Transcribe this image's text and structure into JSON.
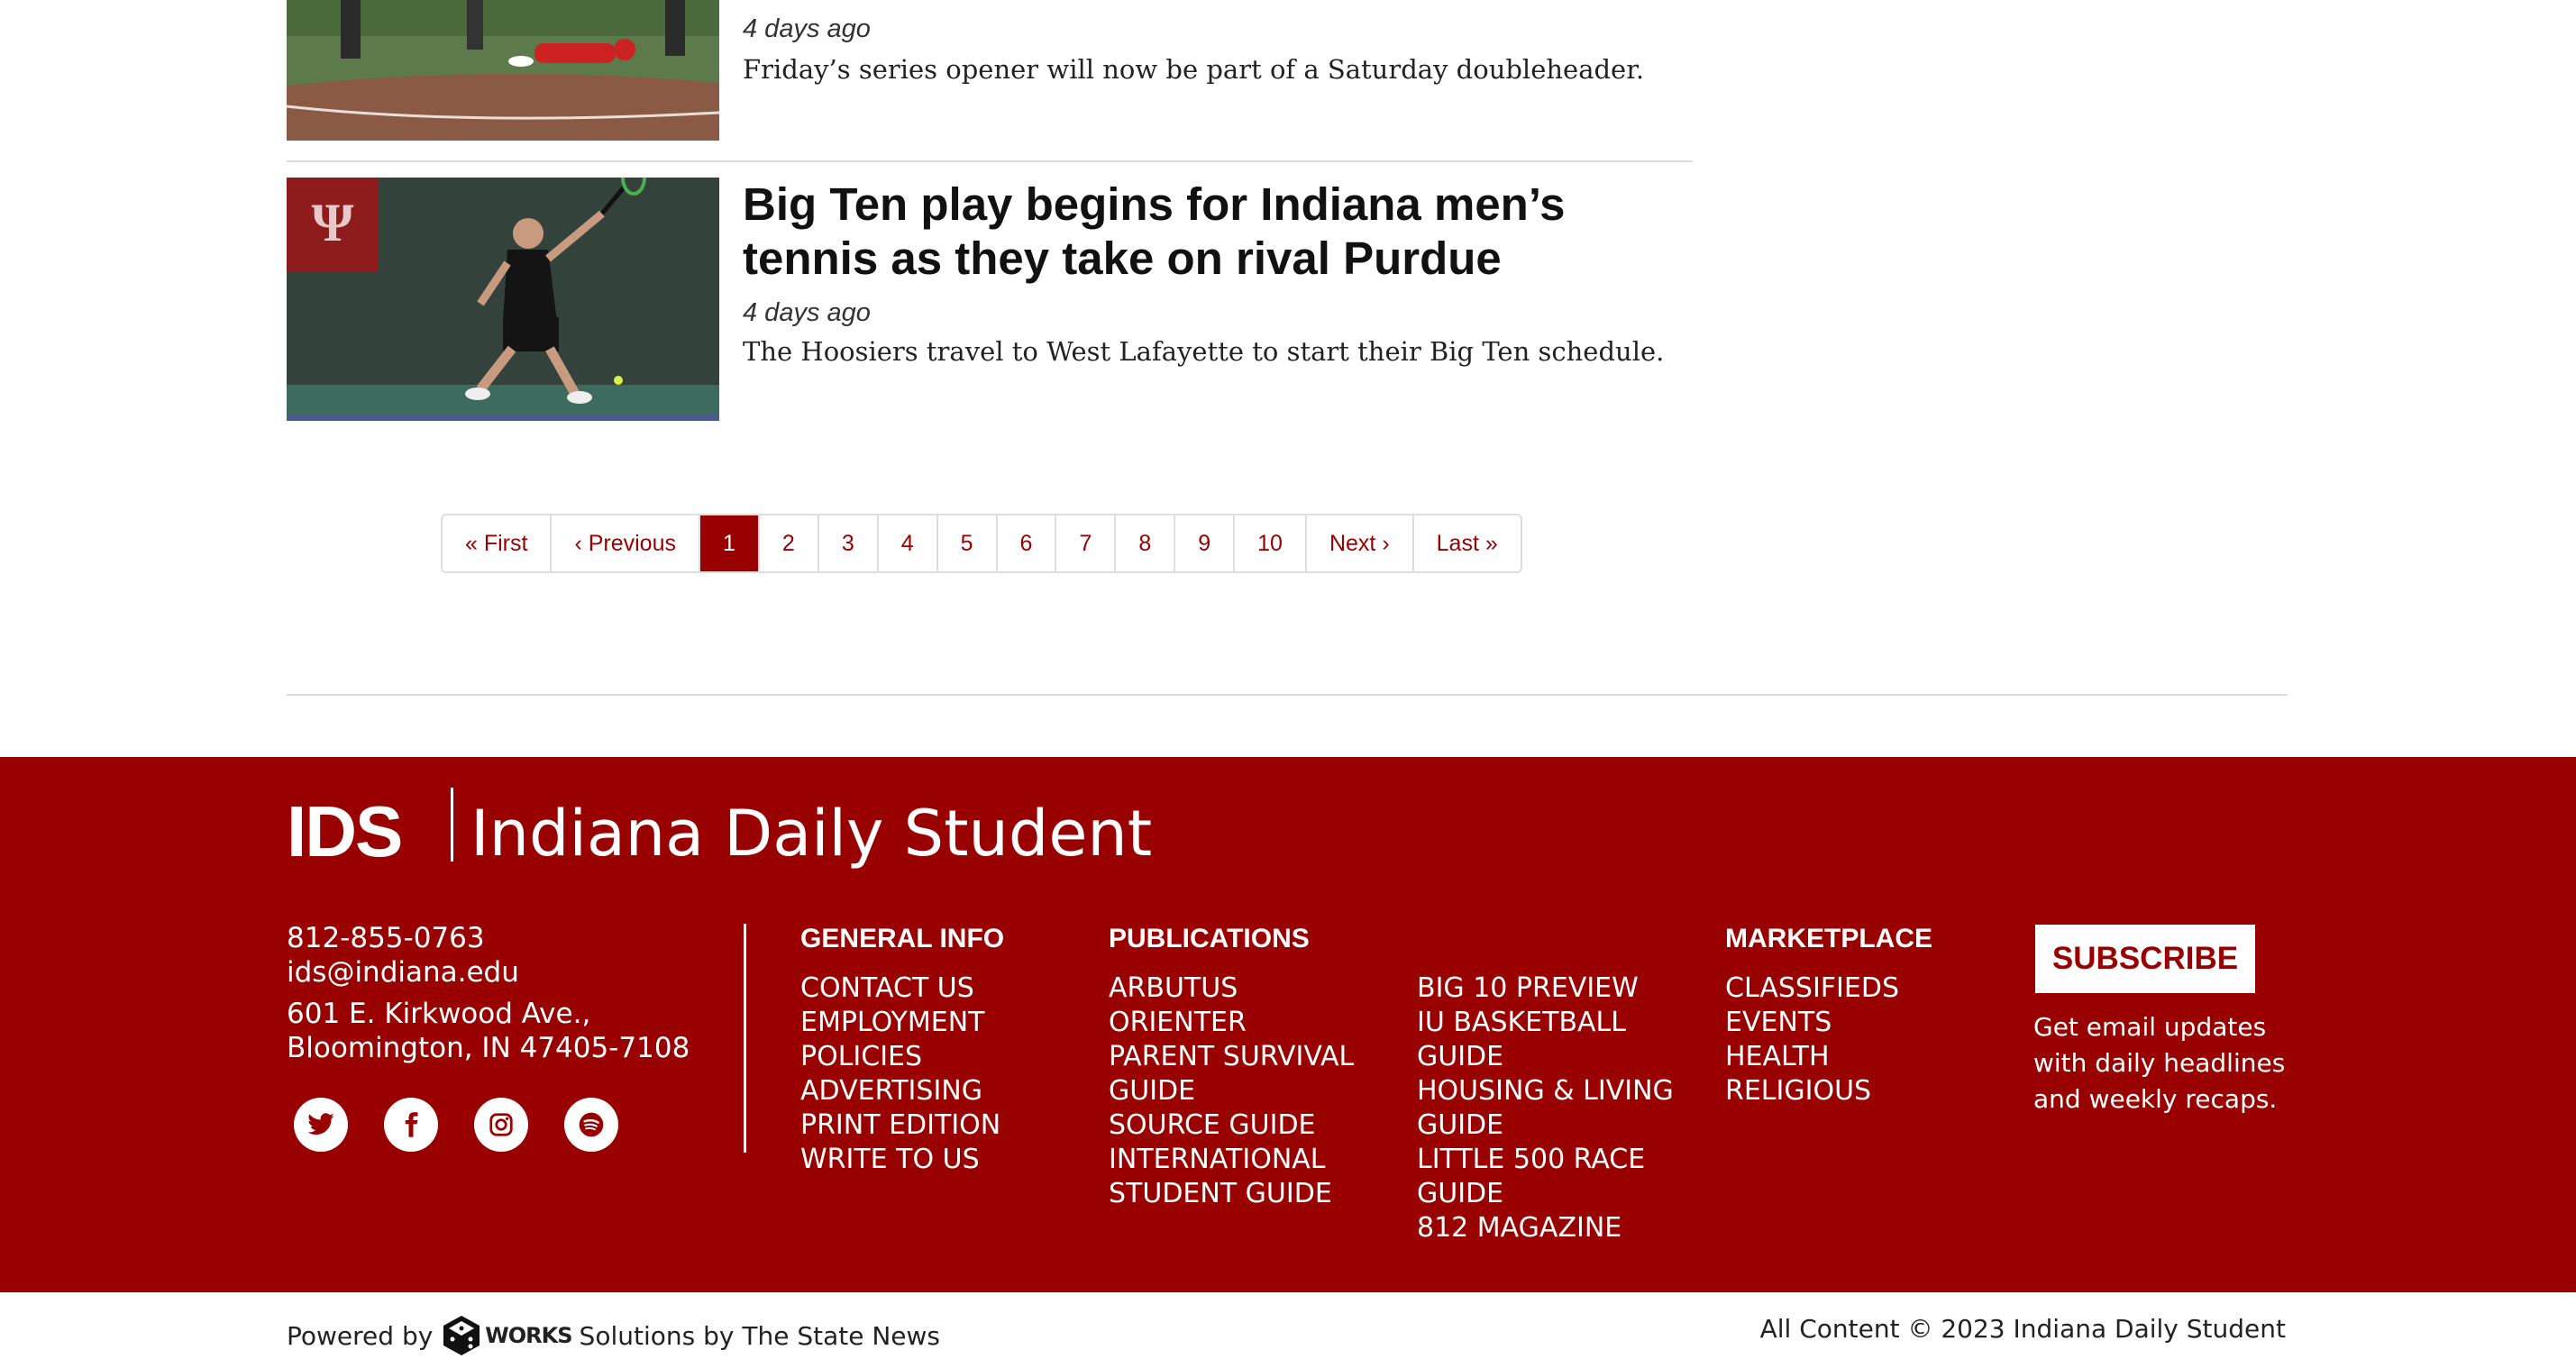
{
  "articles": [
    {
      "date": "4 days ago",
      "dek": "Friday’s series opener will now be part of a Saturday doubleheader."
    },
    {
      "title": "Big Ten play begins for Indiana men’s tennis as they take on rival Purdue",
      "date": "4 days ago",
      "dek": "The Hoosiers travel to West Lafayette to start their Big Ten schedule."
    }
  ],
  "pagination": {
    "first": "« First",
    "previous": "‹ Previous",
    "pages": [
      "1",
      "2",
      "3",
      "4",
      "5",
      "6",
      "7",
      "8",
      "9",
      "10"
    ],
    "active": "1",
    "next": "Next ›",
    "last": "Last »"
  },
  "footer": {
    "logo_short": "IDS",
    "logo_name": "Indiana Daily Student",
    "phone": "812-855-0763",
    "email": "ids@indiana.edu",
    "address_line1": "601 E. Kirkwood Ave.,",
    "address_line2": "Bloomington, IN 47405-7108",
    "social": [
      "twitter-icon",
      "facebook-icon",
      "instagram-icon",
      "spotify-icon"
    ],
    "general_info": {
      "heading": "GENERAL INFO",
      "links": [
        "CONTACT US",
        "EMPLOYMENT",
        "POLICIES",
        "ADVERTISING",
        "PRINT EDITION",
        "WRITE TO US"
      ]
    },
    "publications": {
      "heading": "PUBLICATIONS",
      "links_col1": [
        "ARBUTUS",
        "ORIENTER",
        "PARENT SURVIVAL GUIDE",
        "SOURCE GUIDE",
        "INTERNATIONAL STUDENT GUIDE"
      ],
      "links_col2": [
        "BIG 10 PREVIEW",
        "IU BASKETBALL GUIDE",
        "HOUSING & LIVING GUIDE",
        "LITTLE 500 RACE GUIDE",
        "812 MAGAZINE"
      ]
    },
    "marketplace": {
      "heading": "MARKETPLACE",
      "links": [
        "CLASSIFIEDS",
        "EVENTS",
        "HEALTH",
        "RELIGIOUS"
      ]
    },
    "subscribe_label": "SUBSCRIBE",
    "subscribe_text": "Get email updates with daily headlines and weekly recaps."
  },
  "bottom_bar": {
    "powered_prefix": "Powered by",
    "snworks_logo": "WORKS",
    "powered_suffix": "Solutions by The State News",
    "copyright": "All Content © 2023 Indiana Daily Student"
  },
  "colors": {
    "brand": "#990000",
    "divider": "#dcdcdc"
  }
}
